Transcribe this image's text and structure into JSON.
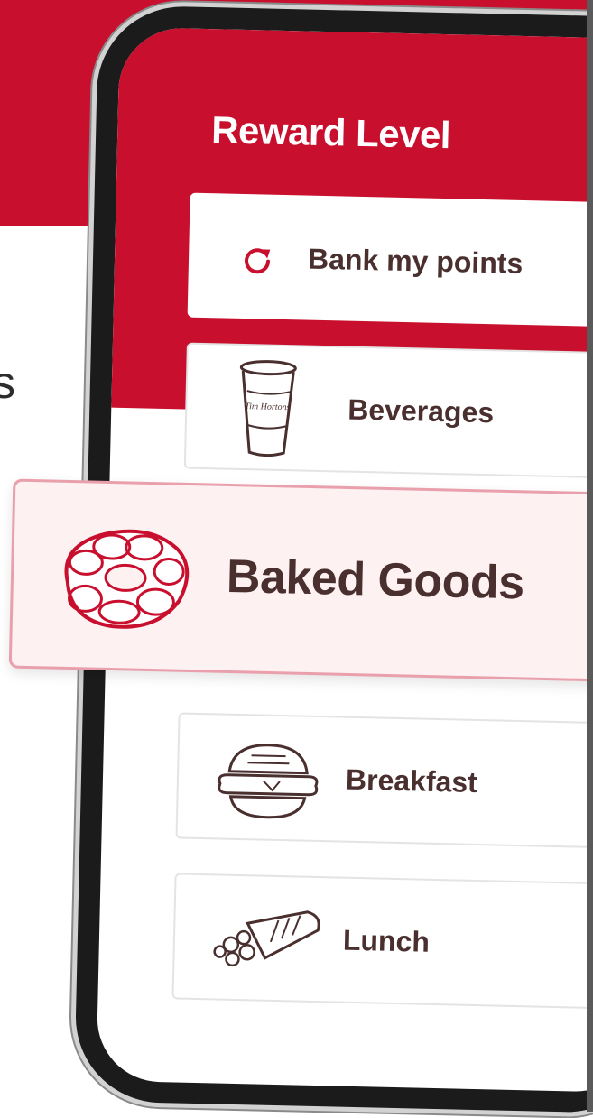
{
  "background": {
    "partial_text": "s"
  },
  "screen": {
    "title": "Reward Level",
    "items": [
      {
        "label": "Bank my points",
        "icon": "refresh-icon"
      },
      {
        "label": "Beverages",
        "icon": "cup-icon",
        "cup_text": "Tim Hortons"
      },
      {
        "label": "Baked Goods",
        "icon": "donut-icon",
        "highlighted": true
      },
      {
        "label": "Breakfast",
        "icon": "breakfast-sandwich-icon"
      },
      {
        "label": "Lunch",
        "icon": "wrap-icon"
      }
    ]
  },
  "colors": {
    "brand_red": "#c8102e",
    "text_brown": "#4a2f2f",
    "highlight_bg": "#fdf1f2",
    "highlight_border": "#e9a0ac"
  }
}
